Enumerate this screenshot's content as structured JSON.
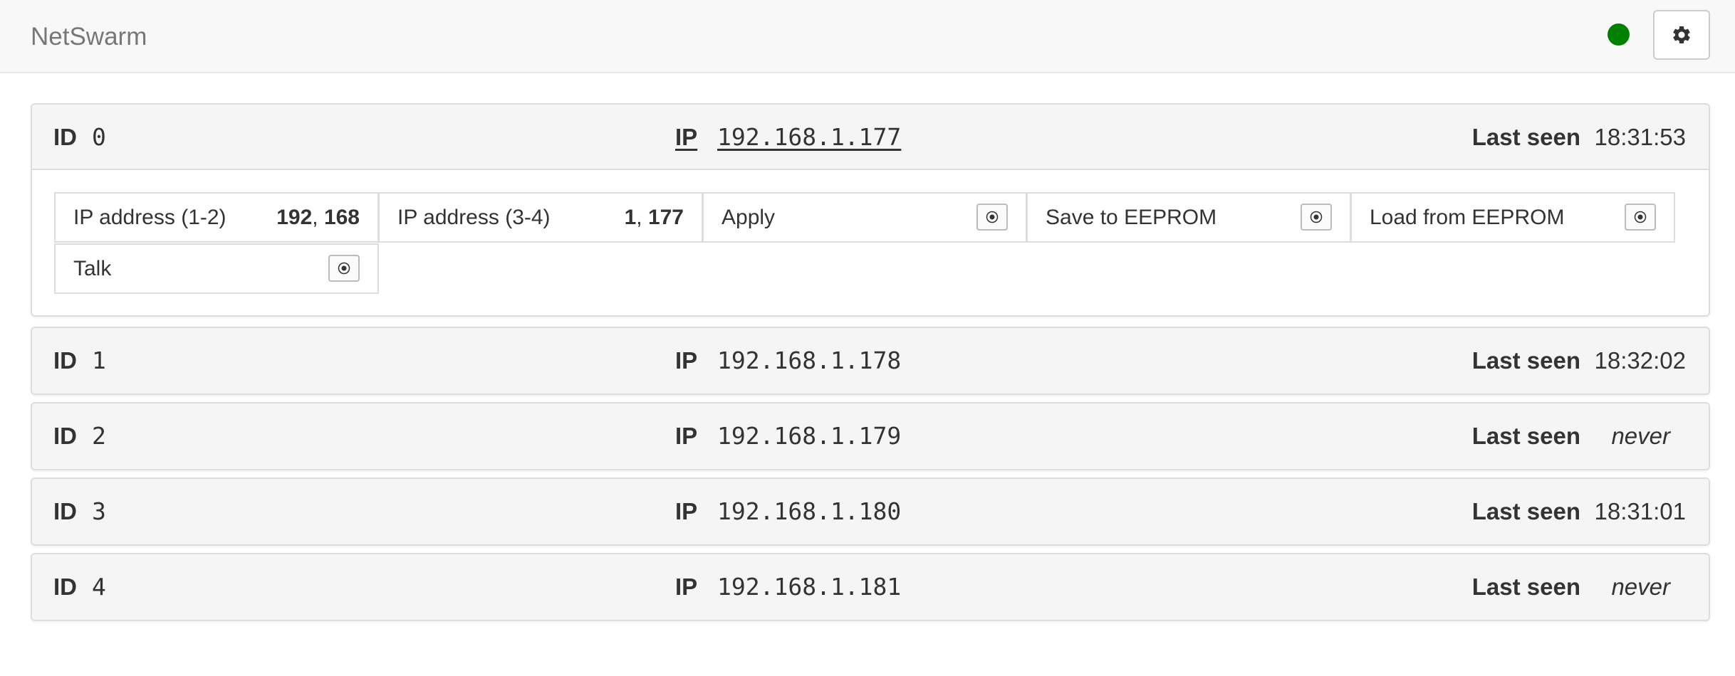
{
  "app": {
    "brand": "NetSwarm",
    "status_color": "#008000",
    "settings_icon": "gear-icon"
  },
  "labels": {
    "id": "ID",
    "ip": "IP",
    "last_seen": "Last seen"
  },
  "nodes": [
    {
      "id": "0",
      "ip": "192.168.1.177",
      "last_seen": "18:31:53",
      "expanded": true,
      "controls": [
        {
          "label": "IP address (1-2)",
          "value_a": "192",
          "sep": ", ",
          "value_b": "168"
        },
        {
          "label": "IP address (3-4)",
          "value_a": "1",
          "sep": ", ",
          "value_b": "177"
        },
        {
          "label": "Apply",
          "button_icon": "radio-dot-icon"
        },
        {
          "label": "Save to EEPROM",
          "button_icon": "radio-dot-icon"
        },
        {
          "label": "Load from EEPROM",
          "button_icon": "radio-dot-icon"
        },
        {
          "label": "Talk",
          "button_icon": "radio-dot-icon"
        }
      ]
    },
    {
      "id": "1",
      "ip": "192.168.1.178",
      "last_seen": "18:32:02"
    },
    {
      "id": "2",
      "ip": "192.168.1.179",
      "last_seen": "never"
    },
    {
      "id": "3",
      "ip": "192.168.1.180",
      "last_seen": "18:31:01"
    },
    {
      "id": "4",
      "ip": "192.168.1.181",
      "last_seen": "never"
    }
  ]
}
